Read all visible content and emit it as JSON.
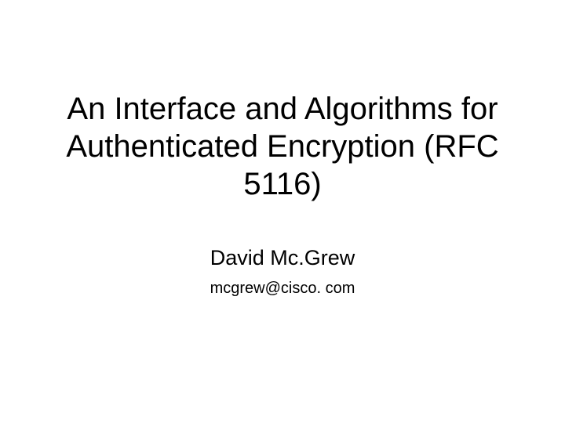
{
  "slide": {
    "title": "An Interface and Algorithms for Authenticated Encryption (RFC 5116)",
    "author": "David Mc.Grew",
    "email": "mcgrew@cisco. com"
  }
}
